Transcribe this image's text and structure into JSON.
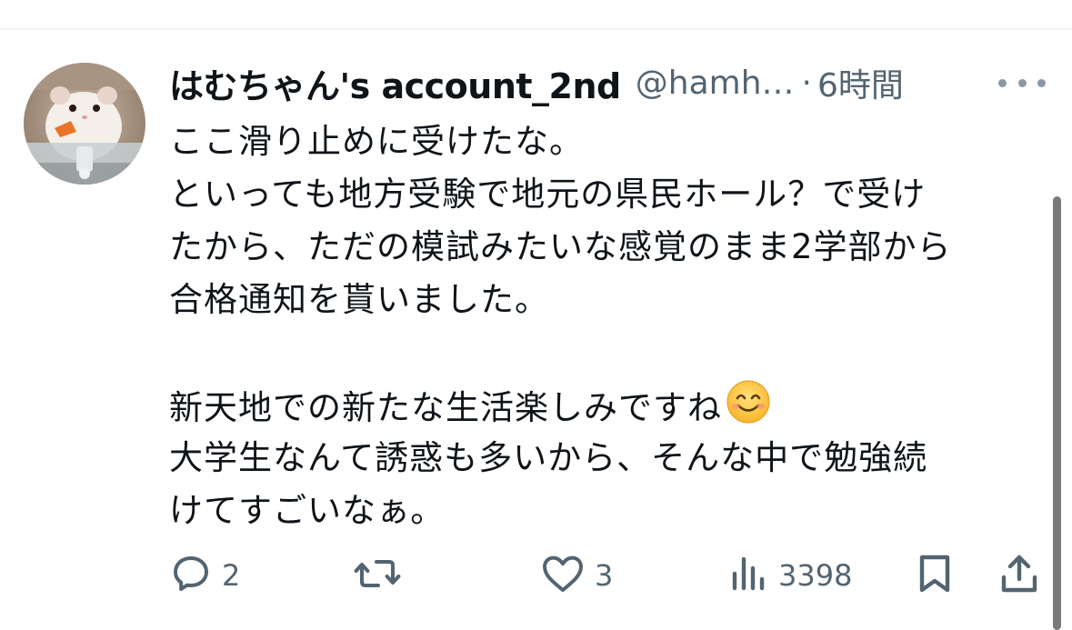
{
  "tweet": {
    "author": {
      "display_name": "はむちゃん's account_2nd",
      "handle": "@hamh…",
      "separator": "·",
      "time": "6時間"
    },
    "body_lines": [
      "ここ滑り止めに受けたな。",
      "といっても地方受験で地元の県民ホール？で受け",
      "たから、ただの模試みたいな感覚のまま2学部から",
      "合格通知を貰いました。",
      "",
      "新天地での新たな生活楽しみですね",
      "大学生なんて誘惑も多いから、そんな中で勉強続",
      "けてすごいなぁ。"
    ],
    "emoji": "smiling-face-emoji",
    "actions": {
      "reply": {
        "icon": "reply-icon",
        "count": "2"
      },
      "retweet": {
        "icon": "retweet-icon",
        "count": ""
      },
      "like": {
        "icon": "heart-icon",
        "count": "3"
      },
      "views": {
        "icon": "views-icon",
        "count": "3398"
      },
      "bookmark": {
        "icon": "bookmark-icon"
      },
      "share": {
        "icon": "share-icon"
      }
    }
  },
  "colors": {
    "text": "#0f1419",
    "secondary": "#536471",
    "icon": "#536471",
    "divider": "#eff3f4"
  }
}
